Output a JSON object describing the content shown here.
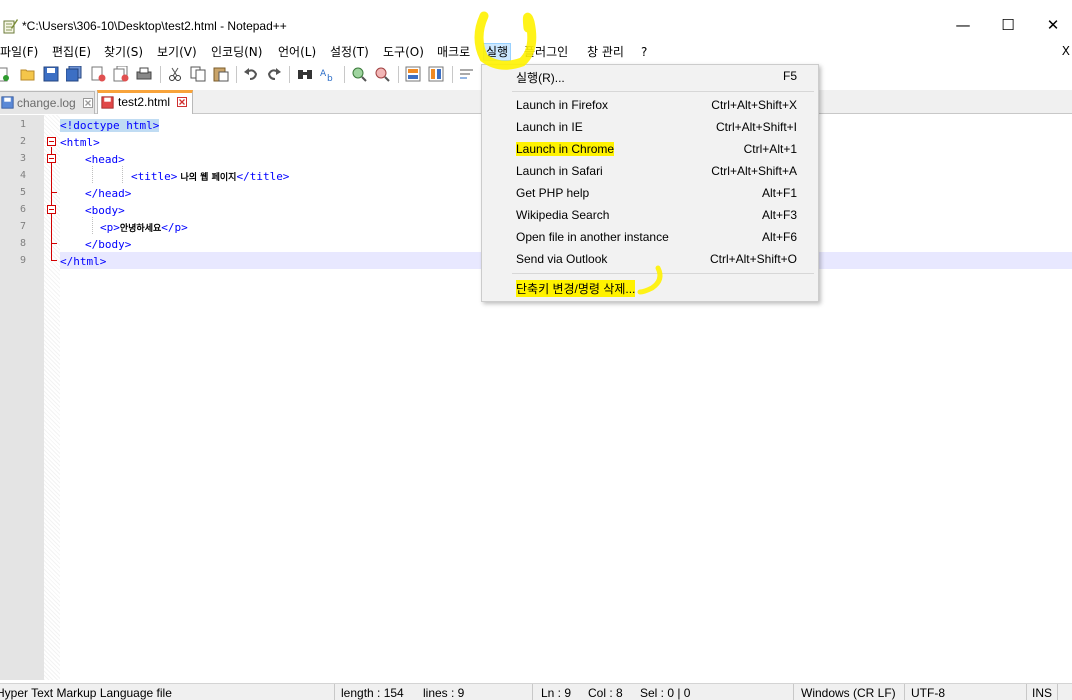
{
  "window": {
    "title": "*C:\\Users\\306-10\\Desktop\\test2.html - Notepad++",
    "minimize": "—",
    "maximize": "☐",
    "close": "✕"
  },
  "menu": {
    "items": [
      "파일(F)",
      "편집(E)",
      "찾기(S)",
      "보기(V)",
      "인코딩(N)",
      "언어(L)",
      "설정(T)",
      "도구(O)",
      "매크로",
      "실행",
      "플러그인",
      "창 관리",
      "?"
    ],
    "active": "실행",
    "close_label": "X"
  },
  "tabs": [
    {
      "label": "change.log",
      "active": false
    },
    {
      "label": "test2.html",
      "active": true
    }
  ],
  "editor": {
    "line_numbers": [
      "1",
      "2",
      "3",
      "4",
      "5",
      "6",
      "7",
      "8",
      "9"
    ],
    "lines": {
      "l1": "<!doctype html>",
      "l2": "<html>",
      "l3": "<head>",
      "l4_open": "<title>",
      "l4_text": " 나의 웹 페이지",
      "l4_close": "</title>",
      "l5": "</head>",
      "l6": "<body>",
      "l7_open": "<p>",
      "l7_text": "안녕하세요",
      "l7_close": "</p>",
      "l8": "</body>",
      "l9": "</html>"
    }
  },
  "run_menu": {
    "items": [
      {
        "label": "실행(R)...",
        "shortcut": "F5",
        "highlighted": false
      },
      {
        "label": "Launch in Firefox",
        "shortcut": "Ctrl+Alt+Shift+X",
        "highlighted": false
      },
      {
        "label": "Launch in IE",
        "shortcut": "Ctrl+Alt+Shift+I",
        "highlighted": false
      },
      {
        "label": "Launch in Chrome",
        "shortcut": "Ctrl+Alt+1",
        "highlighted": true
      },
      {
        "label": "Launch in Safari",
        "shortcut": "Ctrl+Alt+Shift+A",
        "highlighted": false
      },
      {
        "label": "Get PHP help",
        "shortcut": "Alt+F1",
        "highlighted": false
      },
      {
        "label": "Wikipedia Search",
        "shortcut": "Alt+F3",
        "highlighted": false
      },
      {
        "label": "Open file in another instance",
        "shortcut": "Alt+F6",
        "highlighted": false
      },
      {
        "label": "Send via Outlook",
        "shortcut": "Ctrl+Alt+Shift+O",
        "highlighted": false
      },
      {
        "label": "단축키 변경/명령 삭제...",
        "shortcut": "",
        "highlighted": true
      }
    ]
  },
  "statusbar": {
    "file_type": "Hyper Text Markup Language file",
    "length": "length : 154",
    "lines": "lines : 9",
    "ln": "Ln : 9",
    "col": "Col : 8",
    "sel": "Sel : 0 | 0",
    "eol": "Windows (CR LF)",
    "encoding": "UTF-8",
    "mode": "INS"
  },
  "colors": {
    "highlight_yellow": "#fff200",
    "tag_blue": "#0000ff",
    "active_tab_orange": "#f8a33a",
    "fold_red": "#d20000",
    "current_line": "#e8e8ff"
  },
  "icons": [
    "notepad-app-icon",
    "new-file-icon",
    "open-file-icon",
    "save-icon",
    "save-all-icon",
    "close-icon",
    "close-all-icon",
    "print-icon",
    "cut-icon",
    "copy-icon",
    "paste-icon",
    "undo-icon",
    "redo-icon",
    "find-icon",
    "replace-icon",
    "zoom-in-icon",
    "zoom-out-icon",
    "sync-vertical-icon",
    "sync-horizontal-icon",
    "word-wrap-icon"
  ]
}
